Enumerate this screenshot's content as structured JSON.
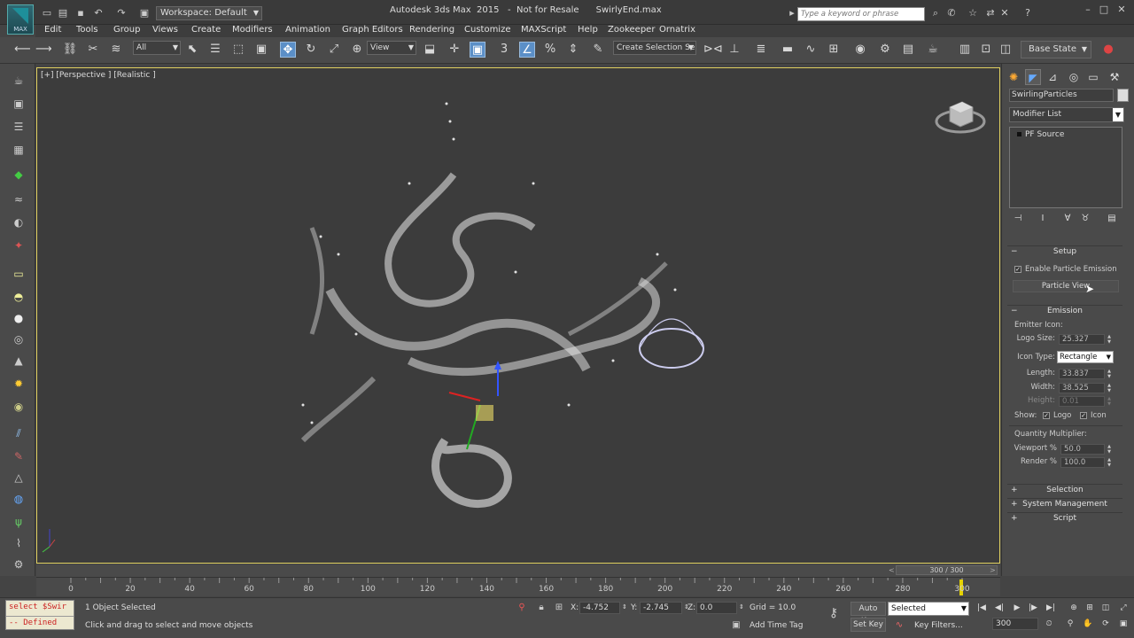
{
  "app": {
    "logo_text": "MAX",
    "title": "Autodesk 3ds Max  2015   -  Not for Resale      SwirlyEnd.max",
    "workspace": "Workspace: Default",
    "search_placeholder": "Type a keyword or phrase"
  },
  "menu": [
    "Edit",
    "Tools",
    "Group",
    "Views",
    "Create",
    "Modifiers",
    "Animation",
    "Graph Editors",
    "Rendering",
    "Customize",
    "MAXScript",
    "Help",
    "Zookeeper",
    "Ornatrix"
  ],
  "toolbar": {
    "filter_select": "All",
    "ref_coord_select": "View",
    "selection_set_placeholder": "Create Selection Se",
    "base_state": "Base State"
  },
  "viewport": {
    "label": "[+] [Perspective ] [Realistic ]"
  },
  "command_panel": {
    "object_name": "SwirlingParticles",
    "modifier_list": "Modifier List",
    "stack_item": "PF Source",
    "setup": {
      "title": "Setup",
      "enable_emission_label": "Enable Particle Emission",
      "enable_emission_checked": true,
      "particle_view_button": "Particle View"
    },
    "emission": {
      "title": "Emission",
      "emitter_icon_label": "Emitter Icon:",
      "logo_size_label": "Logo Size:",
      "logo_size": "25.327",
      "icon_type_label": "Icon Type:",
      "icon_type": "Rectangle",
      "length_label": "Length:",
      "length": "33.837",
      "width_label": "Width:",
      "width": "38.525",
      "height_label": "Height:",
      "height": "0.01",
      "show_label": "Show:",
      "show_logo_label": "Logo",
      "show_logo_checked": true,
      "show_icon_label": "Icon",
      "show_icon_checked": true,
      "quantity_label": "Quantity Multiplier:",
      "viewport_pct_label": "Viewport %",
      "viewport_pct": "50.0",
      "render_pct_label": "Render %",
      "render_pct": "100.0"
    },
    "collapsed_rollouts": [
      "Selection",
      "System Management",
      "Script"
    ]
  },
  "timeline": {
    "slider_text": "300 / 300",
    "ticks": [
      "0",
      "20",
      "40",
      "60",
      "80",
      "100",
      "120",
      "140",
      "160",
      "180",
      "200",
      "220",
      "240",
      "260",
      "280",
      "300"
    ]
  },
  "status": {
    "listener_line1": "select $Swir",
    "listener_line2": "-- Defined",
    "selection_info": "1 Object Selected",
    "prompt": "Click and drag to select and move objects",
    "x_label": "X:",
    "x_value": "-4.752",
    "y_label": "Y:",
    "y_value": "-2.745",
    "z_label": "Z:",
    "z_value": "0.0",
    "grid": "Grid = 10.0",
    "add_time_tag": "Add Time Tag",
    "auto_key": "Auto Key",
    "set_key": "Set Key",
    "key_mode": "Selected",
    "key_filters": "Key Filters...",
    "current_frame": "300"
  }
}
